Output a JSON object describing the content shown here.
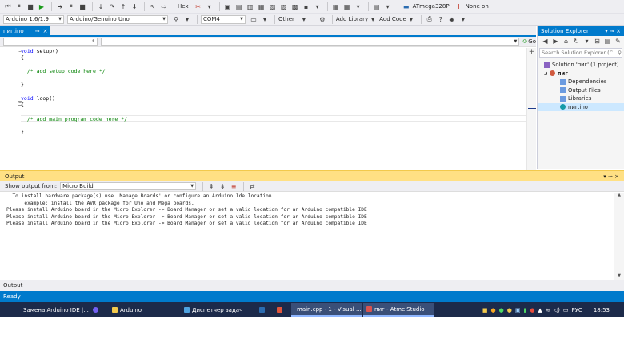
{
  "toolbar_top": {
    "hex_label": "Hex",
    "chip_label": "ATmega328P",
    "none_on_label": "None on"
  },
  "toolbar_board": {
    "version_combo": "Arduino 1.6/1.9",
    "board_combo": "Arduino/Genuino Uno",
    "port_combo": "COM4",
    "other_label": "Other",
    "add_library_label": "Add Library",
    "add_code_label": "Add Code"
  },
  "editor": {
    "tab_label": "пиг.ino",
    "go_label": "Go",
    "code_lines": [
      "void setup()",
      "{",
      "",
      "  /* add setup code here */",
      "",
      "}",
      "",
      "void loop()",
      "{",
      "",
      "  /* add main program code here */",
      "",
      "}"
    ]
  },
  "solution_explorer": {
    "title": "Solution Explorer",
    "search_placeholder": "Search Solution Explorer (C",
    "tree": [
      {
        "label": "Solution 'пиг' (1 project)",
        "icon": "solution-icon",
        "indent": 0
      },
      {
        "label": "пиг",
        "icon": "project-icon",
        "indent": 1
      },
      {
        "label": "Dependencies",
        "icon": "folder-icon",
        "indent": 2
      },
      {
        "label": "Output Files",
        "icon": "folder-icon",
        "indent": 2
      },
      {
        "label": "Libraries",
        "icon": "folder-icon",
        "indent": 2
      },
      {
        "label": "пиг.ino",
        "icon": "arduino-file-icon",
        "indent": 2
      }
    ]
  },
  "output": {
    "title": "Output",
    "show_from_label": "Show output from:",
    "source_combo": "Micro Build",
    "lines": [
      "  To install hardware package(s) use 'Manage Boards' or configure an Arduino Ide location.",
      "      example: install the AVR package for Uno and Mega boards.",
      "Please install Arduino board in the Micro Explorer -> Board Manager or set a valid location for an Arduino compatible IDE",
      "Please install Arduino board in the Micro Explorer -> Board Manager or set a valid location for an Arduino compatible IDE",
      "Please install Arduino board in the Micro Explorer -> Board Manager or set a valid location for an Arduino compatible IDE"
    ],
    "bottom_tab": "Output"
  },
  "status": {
    "text": "Ready"
  },
  "taskbar": {
    "items": [
      {
        "label": "Замена Arduino IDE |...",
        "icon_color": "#ff7a00",
        "active": false
      },
      {
        "label": "",
        "icon_color": "#7360f2",
        "active": false
      },
      {
        "label": "Arduino",
        "icon_color": "#f2c94c",
        "active": false
      },
      {
        "label": "Диспетчер задач",
        "icon_color": "#4fa3e0",
        "active": false
      },
      {
        "label": "",
        "icon_color": "#2b6cb0",
        "active": false
      },
      {
        "label": "",
        "icon_color": "#e0553b",
        "active": false
      },
      {
        "label": "main.cpp - 1 - Visual ...",
        "icon_color": "#865fc5",
        "active": true
      },
      {
        "label": "пиг - AtmelStudio",
        "icon_color": "#d9534f",
        "active": true
      }
    ],
    "language": "РУС",
    "time": "18:53"
  },
  "colors": {
    "accent": "#007acc",
    "output_title": "#ffe084",
    "taskbar": "#1c2a4a"
  }
}
